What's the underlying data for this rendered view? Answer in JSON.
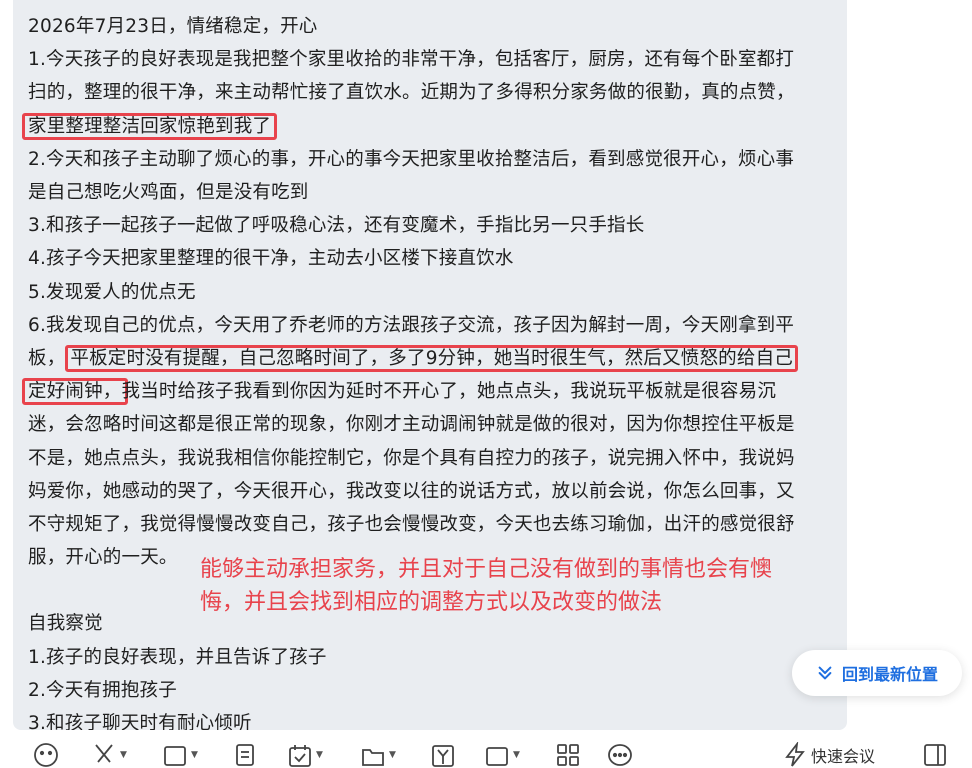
{
  "message": {
    "lines": [
      "2026年7月23日，情绪稳定，开心",
      "1.今天孩子的良好表现是我把整个家里收拾的非常干净，包括客厅，厨房，还有每个卧室都打",
      "扫的，整理的很干净，来主动帮忙接了直饮水。近期为了多得积分家务做的很勤，真的点赞，",
      "家里整理整洁回家惊艳到我了",
      "2.今天和孩子主动聊了烦心的事，开心的事今天把家里收拾整洁后，看到感觉很开心，烦心事",
      "是自己想吃火鸡面，但是没有吃到",
      "3.和孩子一起孩子一起做了呼吸稳心法，还有变魔术，手指比另一只手指长",
      "4.孩子今天把家里整理的很干净，主动去小区楼下接直饮水",
      "5.发现爱人的优点无",
      "6.我发现自己的优点，今天用了乔老师的方法跟孩子交流，孩子因为解封一周，今天刚拿到平",
      "板，",
      "平板定时没有提醒，自己忽略时间了，多了9分钟，她当时很生气，然后又愤怒的给自己",
      "定好闹钟，",
      "我当时给孩子我看到你因为延时不开心了，她点点头，我说玩平板就是很容易沉",
      "迷，会忽略时间这都是很正常的现象，你刚才主动调闹钟就是做的很对，因为你想控住平板是",
      "不是，她点点头，我说我相信你能控制它，你是个具有自控力的孩子，说完拥入怀中，我说妈",
      "妈爱你，她感动的哭了，今天很开心，我改变以往的说话方式，放以前会说，你怎么回事，又",
      "不守规矩了，我觉得慢慢改变自己，孩子也会慢慢改变，今天也去练习瑜伽，出汗的感觉很舒",
      "服，开心的一天。",
      "自我察觉",
      "1.孩子的良好表现，并且告诉了孩子",
      "2.今天有拥抱孩子",
      "3.和孩子聊天时有耐心倾听"
    ]
  },
  "annotation": {
    "line1": "能够主动承担家务，并且对于自己没有做到的事情也会有懊",
    "line2": "悔，并且会找到相应的调整方式以及改变的做法"
  },
  "jump_button": {
    "label": "回到最新位置",
    "icon": "double-chevron-down-icon"
  },
  "toolbar": {
    "items": [
      {
        "icon": "emoji-icon"
      },
      {
        "icon": "scissors-icon"
      },
      {
        "icon": "image-icon"
      },
      {
        "icon": "document-icon"
      },
      {
        "icon": "calendar-check-icon"
      },
      {
        "icon": "folder-icon"
      },
      {
        "icon": "yen-icon"
      },
      {
        "icon": "live-icon"
      },
      {
        "icon": "apps-icon"
      },
      {
        "icon": "chat-bubble-icon"
      }
    ],
    "quick_meeting_label": "快速会议",
    "quick_meeting_icon": "lightning-icon",
    "panel_icon": "sidebar-panel-icon"
  },
  "colors": {
    "highlight": "#e8434c",
    "accent": "#1f6fe0",
    "bubble": "#eaedf1"
  }
}
